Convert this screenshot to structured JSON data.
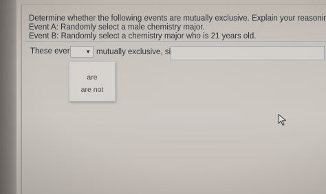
{
  "question": {
    "line1": "Determine whether the following events are mutually exclusive. Explain your reasoning.",
    "line2": "Event A: Randomly select a male chemistry major.",
    "line3": "Event B: Randomly select a chemistry major who is 21 years old."
  },
  "answer": {
    "prefix": "These events",
    "select_value": "",
    "select_arrow": "▼",
    "suffix": "mutually exclusive, since",
    "reason_value": ""
  },
  "dropdown": {
    "options": [
      "are",
      "are not"
    ]
  },
  "colors": {
    "text": "#2b2f3a",
    "border": "#98a3ae",
    "background": "#c9c4bd"
  },
  "icons": {
    "cursor": "mouse-pointer-icon",
    "arrow": "dropdown-arrow-icon"
  }
}
